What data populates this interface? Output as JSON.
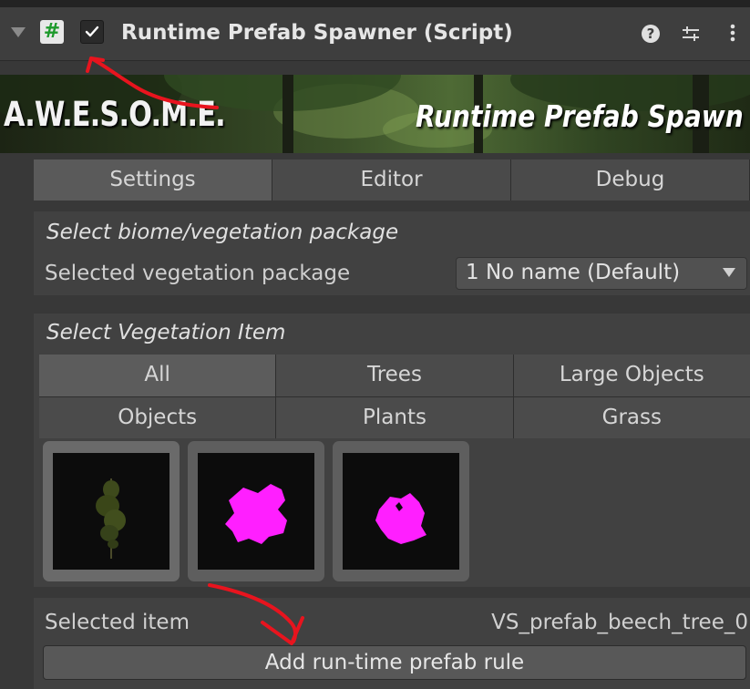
{
  "header": {
    "title": "Runtime Prefab Spawner (Script)",
    "script_icon_glyph": "#",
    "enabled": true,
    "help_glyph": "❓",
    "preset_glyph": "⇅",
    "more_glyph": "⋮"
  },
  "banner": {
    "logo_text": "A.W.E.S.O.M.E.",
    "title": "Runtime Prefab Spawn"
  },
  "tabs": [
    {
      "label": "Settings",
      "active": true
    },
    {
      "label": "Editor",
      "active": false
    },
    {
      "label": "Debug",
      "active": false
    }
  ],
  "biome": {
    "heading": "Select biome/vegetation package",
    "field_label": "Selected vegetation package",
    "selected_value": "1 No name (Default)"
  },
  "vegetation": {
    "heading": "Select Vegetation Item",
    "categories": [
      {
        "label": "All",
        "active": true
      },
      {
        "label": "Trees",
        "active": false
      },
      {
        "label": "Large Objects",
        "active": false
      },
      {
        "label": "Objects",
        "active": false
      },
      {
        "label": "Plants",
        "active": false
      },
      {
        "label": "Grass",
        "active": false
      }
    ],
    "items": [
      {
        "name": "tree-thumbnail",
        "selected": true
      },
      {
        "name": "magenta-object-thumbnail-1",
        "selected": false
      },
      {
        "name": "magenta-object-thumbnail-2",
        "selected": false
      }
    ]
  },
  "selection": {
    "label": "Selected item",
    "value": "VS_prefab_beech_tree_0"
  },
  "actions": {
    "add_rule_label": "Add run-time prefab rule"
  },
  "colors": {
    "annotation_red": "#e8141e",
    "script_icon_green": "#1e9a2c",
    "missing_material_magenta": "#ff1fff"
  }
}
